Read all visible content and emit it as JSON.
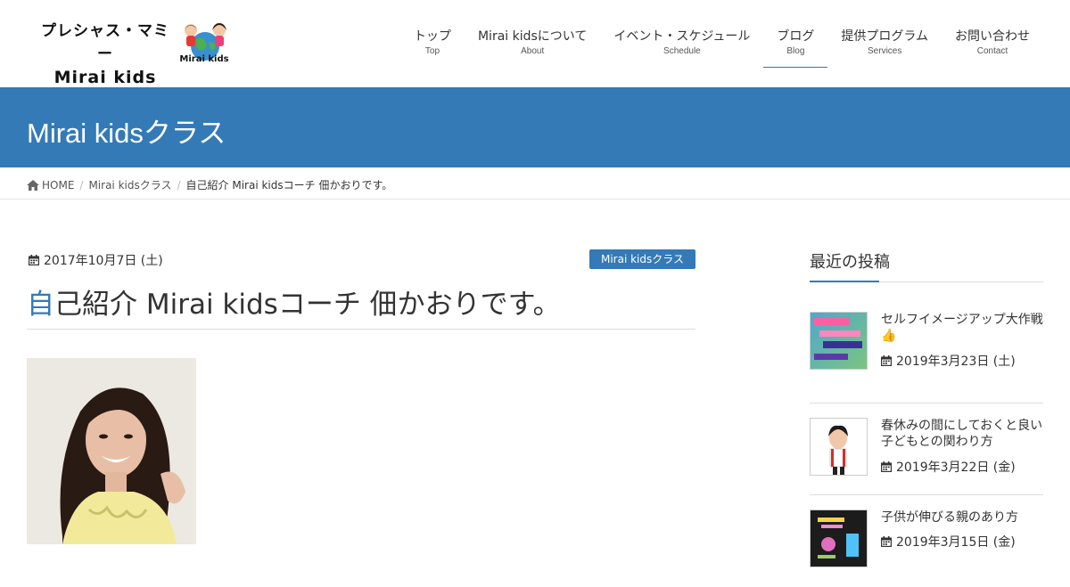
{
  "header": {
    "logo": {
      "line1": "プレシャス・マミー",
      "line2": "Mirai kids",
      "mascot_label": "Mirai kids"
    },
    "nav": [
      {
        "label": "トップ",
        "sub": "Top",
        "active": false
      },
      {
        "label": "Mirai kidsについて",
        "sub": "About",
        "active": false
      },
      {
        "label": "イベント・スケジュール",
        "sub": "Schedule",
        "active": false
      },
      {
        "label": "ブログ",
        "sub": "Blog",
        "active": true
      },
      {
        "label": "提供プログラム",
        "sub": "Services",
        "active": false
      },
      {
        "label": "お問い合わせ",
        "sub": "Contact",
        "active": false
      }
    ]
  },
  "banner": {
    "title": "Mirai kidsクラス"
  },
  "breadcrumb": {
    "home": "HOME",
    "category": "Mirai kidsクラス",
    "current": "自己紹介 Mirai kidsコーチ 佃かおりです。"
  },
  "article": {
    "date": "2017年10月7日 (土)",
    "category": "Mirai kidsクラス",
    "title_first": "自",
    "title_rest": "己紹介 Mirai kidsコーチ 佃かおりです。"
  },
  "sidebar": {
    "heading": "最近の投稿",
    "posts": [
      {
        "title": "セルフイメージアップ大作戦👍",
        "date": "2019年3月23日 (土)"
      },
      {
        "title": "春休みの間にしておくと良い子どもとの関わり方",
        "date": "2019年3月22日 (金)"
      },
      {
        "title": "子供が伸びる親のあり方",
        "date": "2019年3月15日 (金)"
      }
    ]
  },
  "colors": {
    "accent": "#337ab7",
    "text": "#333333",
    "border": "#dddddd"
  },
  "icons": {
    "home": "home-icon",
    "calendar": "calendar-icon"
  }
}
